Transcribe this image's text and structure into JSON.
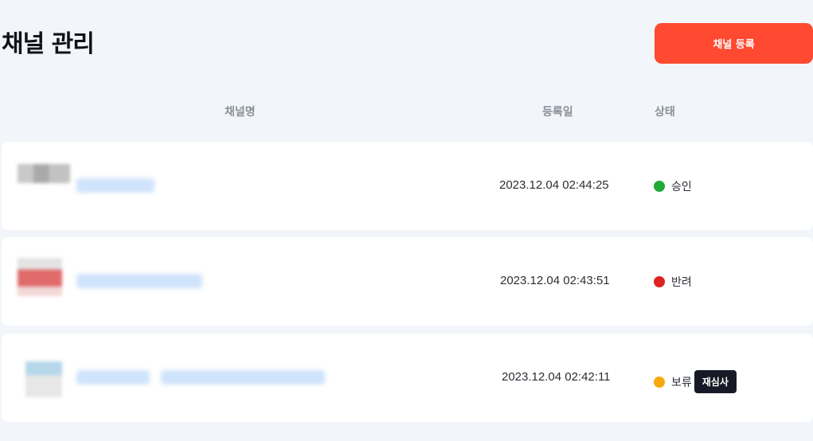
{
  "header": {
    "title": "채널 관리",
    "register_button_label": "채널 등록"
  },
  "table": {
    "columns": {
      "name": "채널명",
      "date": "등록일",
      "status": "상태"
    },
    "rows": [
      {
        "date": "2023.12.04 02:44:25",
        "status": "승인",
        "status_color": "#1faa35"
      },
      {
        "date": "2023.12.04 02:43:51",
        "status": "반려",
        "status_color": "#e02222"
      },
      {
        "date": "2023.12.04 02:42:11",
        "status": "보류",
        "status_color": "#f6a80c",
        "action_label": "재심사"
      }
    ]
  },
  "colors": {
    "accent": "#ff4930",
    "background": "#f2f5f9"
  }
}
